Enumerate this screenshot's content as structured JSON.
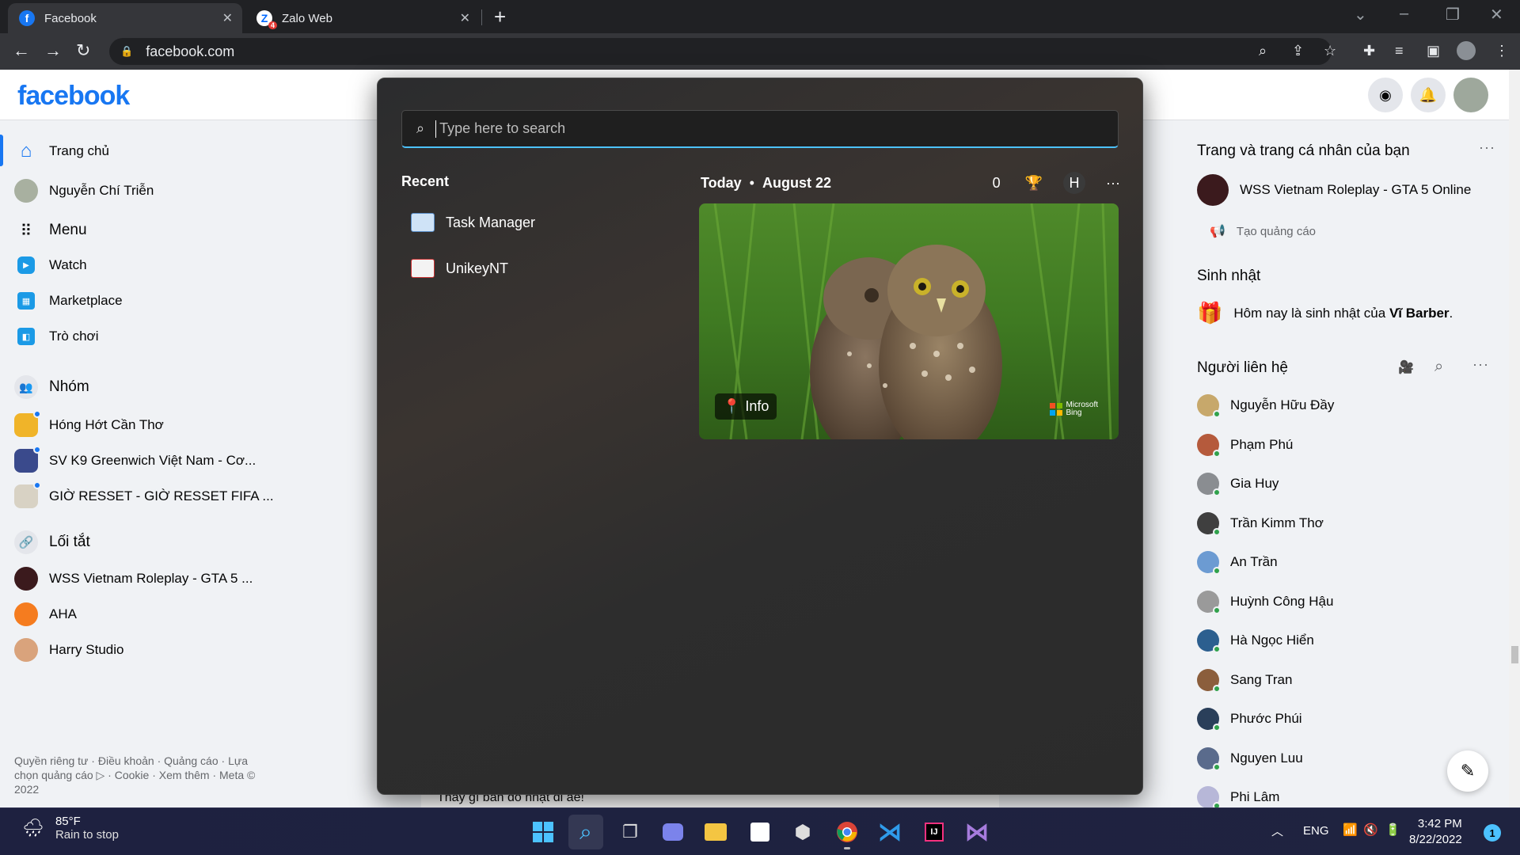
{
  "browser": {
    "tabs": [
      {
        "title": "Facebook",
        "active": true
      },
      {
        "title": "Zalo Web",
        "active": false,
        "badge": "4"
      }
    ],
    "url": "facebook.com"
  },
  "facebook": {
    "logo": "facebook",
    "left_nav": {
      "home": "Trang chủ",
      "profile": "Nguyễn Chí Triễn",
      "menu": "Menu",
      "watch": "Watch",
      "marketplace": "Marketplace",
      "games": "Trò chơi",
      "groups_header": "Nhóm",
      "groups": [
        "Hóng Hớt Cần Thơ",
        "SV K9 Greenwich Việt Nam - Cơ...",
        "GIỜ RESSET - GIỜ RESSET FIFA ..."
      ],
      "shortcuts_header": "Lối tắt",
      "shortcuts": [
        "WSS Vietnam Roleplay - GTA 5 ...",
        "AHA",
        "Harry Studio"
      ],
      "footer": "Quyền riêng tư · Điều khoản · Quảng cáo · Lựa chọn quảng cáo ▷ · Cookie · Xem thêm · Meta © 2022"
    },
    "right_col": {
      "pages_header": "Trang và trang cá nhân của bạn",
      "page_name": "WSS Vietnam Roleplay - GTA 5 Online",
      "create_ad": "Tạo quảng cáo",
      "birthday_header": "Sinh nhật",
      "birthday_prefix": "Hôm nay là sinh nhật của ",
      "birthday_name": "Vĩ Barber",
      "birthday_suffix": ".",
      "contacts_header": "Người liên hệ",
      "contacts": [
        "Nguyễn Hữu Đầy",
        "Phạm Phú",
        "Gia Huy",
        "Trần Kimm Thơ",
        "An Trần",
        "Huỳnh Công Hậu",
        "Hà Ngọc Hiển",
        "Sang Tran",
        "Phước Phúi",
        "Nguyen Luu",
        "Phi Lâm"
      ]
    },
    "post_snippet": "Thấy gì bán đó nhặt đi ae!"
  },
  "search_flyout": {
    "placeholder": "Type here to search",
    "recent_header": "Recent",
    "recent_items": [
      "Task Manager",
      "UnikeyNT"
    ],
    "today_label": "Today",
    "date": "August 22",
    "points": "0",
    "user_initial": "H",
    "more": "···",
    "info_label": "Info",
    "bing_label_1": "Microsoft",
    "bing_label_2": "Bing"
  },
  "taskbar": {
    "weather_temp": "85°F",
    "weather_condition": "Rain to stop",
    "language": "ENG",
    "time": "3:42 PM",
    "date": "8/22/2022",
    "notification_count": "1"
  },
  "colors": {
    "facebook_blue": "#1877f2",
    "search_accent": "#4cc2ff",
    "online_green": "#31a24c"
  }
}
